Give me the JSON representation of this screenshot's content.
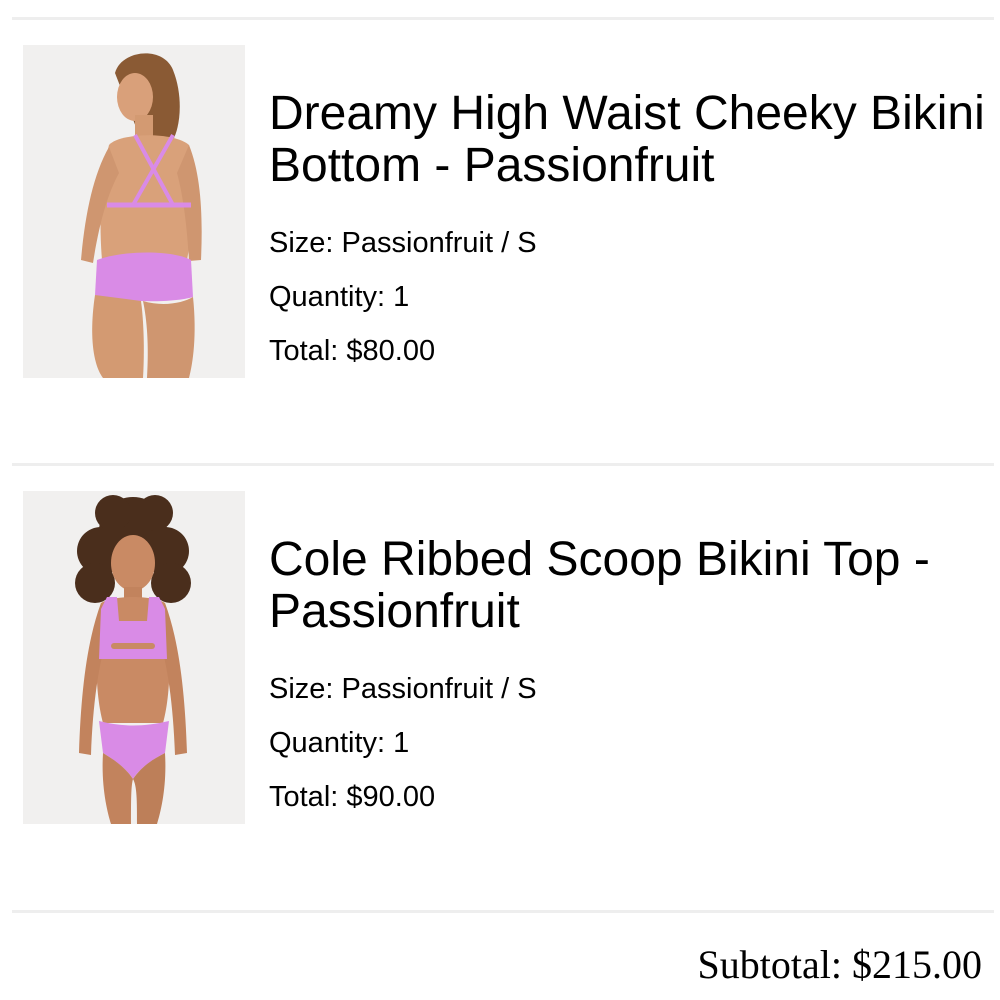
{
  "cart": {
    "items": [
      {
        "title": "Dreamy High Waist Cheeky Bikini Bottom - Passionfruit",
        "size_label": "Size:",
        "size_value": "Passionfruit / S",
        "quantity_label": "Quantity:",
        "quantity_value": "1",
        "total_label": "Total:",
        "total_value": "$80.00",
        "image_icon": "product-photo-back-view"
      },
      {
        "title": "Cole Ribbed Scoop Bikini Top - Passionfruit",
        "size_label": "Size:",
        "size_value": "Passionfruit / S",
        "quantity_label": "Quantity:",
        "quantity_value": "1",
        "total_label": "Total:",
        "total_value": "$90.00",
        "image_icon": "product-photo-front-view"
      }
    ],
    "subtotal_label": "Subtotal:",
    "subtotal_value": "$215.00"
  },
  "colors": {
    "accent": "#d98be6",
    "divider": "#eeeeee",
    "text": "#000000",
    "image_bg": "#f1f0ef"
  }
}
